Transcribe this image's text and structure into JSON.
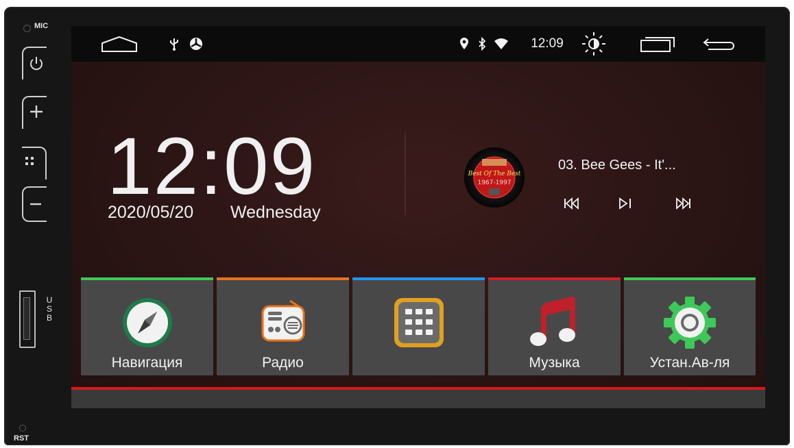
{
  "bezel": {
    "mic_label": "MIC",
    "usb_label": "USB",
    "rst_label": "RST"
  },
  "status_bar": {
    "time": "12:09",
    "icons": [
      "home-icon",
      "usb-icon",
      "fan-icon",
      "location-icon",
      "bluetooth-icon",
      "wifi-icon",
      "brightness-icon",
      "recent-apps-icon",
      "back-icon"
    ]
  },
  "clock": {
    "time": "12:09",
    "date": "2020/05/20",
    "weekday": "Wednesday"
  },
  "media": {
    "track": "03. Bee Gees - It'...",
    "album_text": "Best Of The Best 1967-1997"
  },
  "apps": [
    {
      "label": "Навигация",
      "icon": "compass-icon",
      "strip_color": "#3ec85a"
    },
    {
      "label": "Радио",
      "icon": "radio-icon",
      "strip_color": "#e8731c"
    },
    {
      "label": "",
      "icon": "app-grid-icon",
      "strip_color": "#2196f3"
    },
    {
      "label": "Музыка",
      "icon": "music-note-icon",
      "strip_color": "#d0202a"
    },
    {
      "label": "Устан.Ав-ля",
      "icon": "settings-gear-icon",
      "strip_color": "#3ec85a"
    }
  ],
  "colors": {
    "accent_red": "#d91818",
    "tile_bg": "#484848",
    "screen_bg": "#2c1717"
  }
}
